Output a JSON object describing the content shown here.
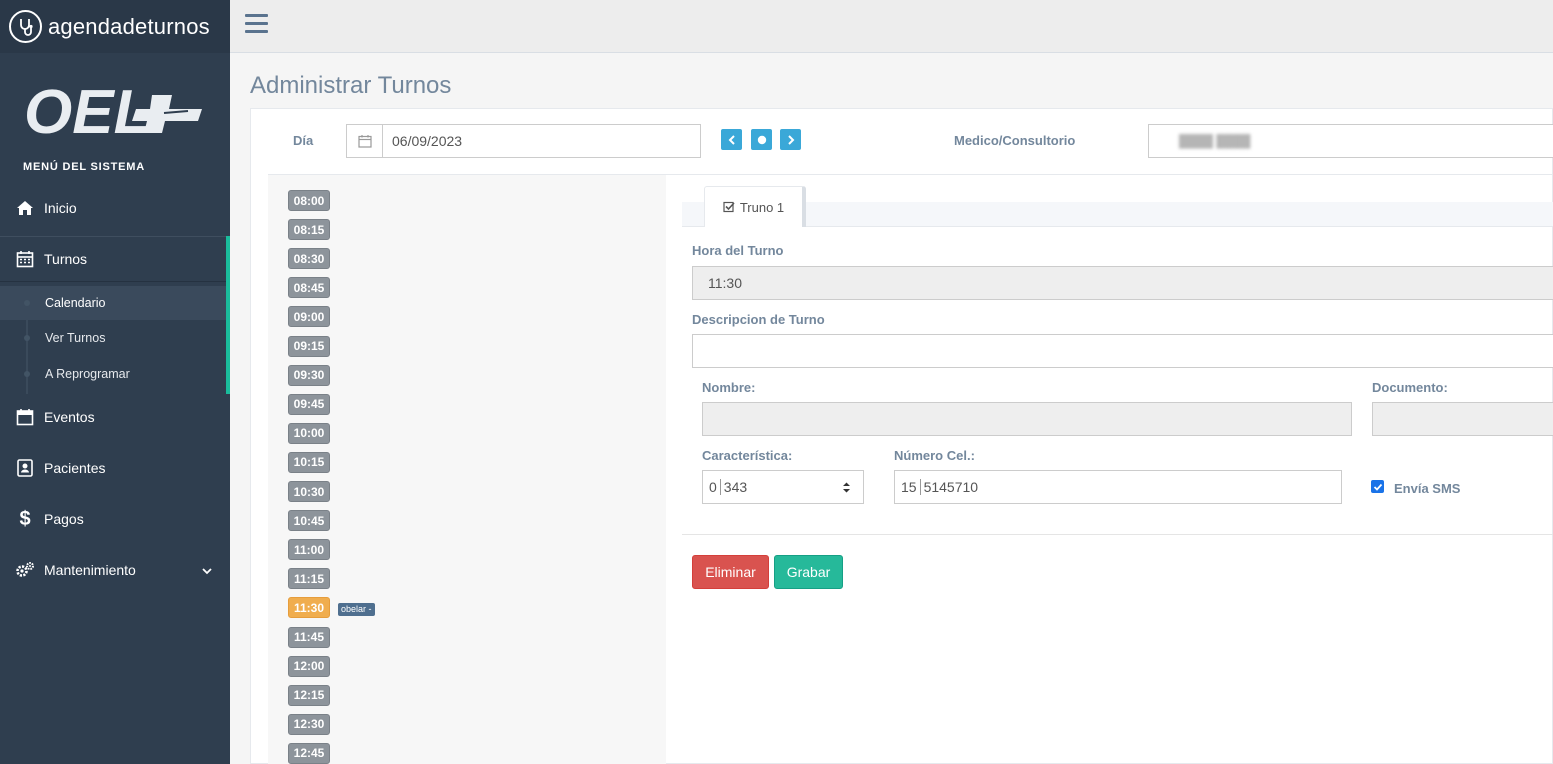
{
  "brand": {
    "name": "agendadeturnos",
    "logo_text": "OEL"
  },
  "sidebar": {
    "menu_title": "MENÚ DEL SISTEMA",
    "items": [
      {
        "label": "Inicio",
        "icon": "home-icon"
      },
      {
        "label": "Turnos",
        "icon": "calendar-icon"
      },
      {
        "label": "Eventos",
        "icon": "calendar-blank-icon"
      },
      {
        "label": "Pacientes",
        "icon": "contact-book-icon"
      },
      {
        "label": "Pagos",
        "icon": "dollar-icon"
      },
      {
        "label": "Mantenimiento",
        "icon": "gears-icon"
      }
    ],
    "subitems": [
      {
        "label": "Calendario"
      },
      {
        "label": "Ver Turnos"
      },
      {
        "label": "A Reprogramar"
      }
    ]
  },
  "page": {
    "title": "Administrar Turnos"
  },
  "filters": {
    "day_label": "Día",
    "day_value": "06/09/2023",
    "doctor_label": "Medico/Consultorio",
    "doctor_value": "████ ████"
  },
  "slots": {
    "times": [
      "08:00",
      "08:15",
      "08:30",
      "08:45",
      "09:00",
      "09:15",
      "09:30",
      "09:45",
      "10:00",
      "10:15",
      "10:30",
      "10:45",
      "11:00",
      "11:15",
      "11:30",
      "11:45",
      "12:00",
      "12:15",
      "12:30",
      "12:45"
    ],
    "selected": "11:30",
    "tag": "obelar -"
  },
  "form": {
    "tab_label": "Truno 1",
    "hora_label": "Hora del Turno",
    "hora_value": "11:30",
    "descripcion_label": "Descripcion de Turno",
    "descripcion_value": "",
    "nombre_label": "Nombre:",
    "nombre_value": "",
    "documento_label": "Documento:",
    "documento_value": "",
    "caracteristica_label": "Característica:",
    "caracteristica_prefix": "0",
    "caracteristica_value": "343",
    "celular_label": "Número Cel.:",
    "celular_prefix": "15",
    "celular_value": "5145710",
    "sms_label": "Envía SMS",
    "sms_checked": true
  },
  "actions": {
    "delete_label": "Eliminar",
    "save_label": "Grabar"
  },
  "colors": {
    "sidebar": "#2f3e4f",
    "accent": "#1abc9c",
    "slot": "#8d949b",
    "slot_selected": "#f0ad4e",
    "danger": "#d9534f",
    "success": "#26b99a",
    "info": "#3aa8d8"
  }
}
